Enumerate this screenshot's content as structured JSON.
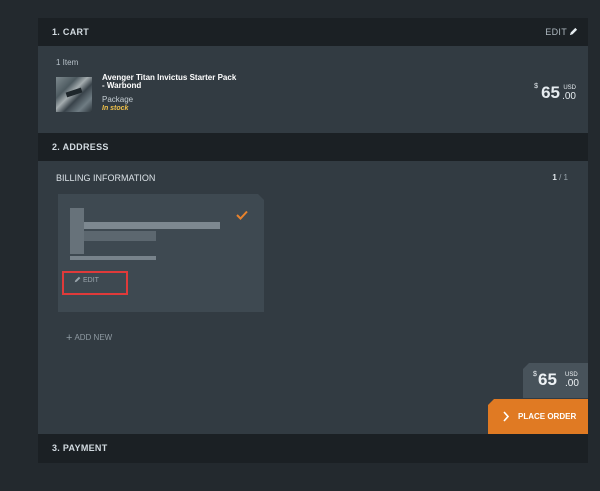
{
  "cart": {
    "header": "1. CART",
    "edit_label": "EDIT",
    "item_count": "1 Item",
    "item": {
      "name": "Avenger Titan Invictus Starter Pack - Warbond",
      "type": "Package",
      "stock": "In stock",
      "currency_symbol": "$",
      "price": "65",
      "cents": ".00",
      "currency": "USD"
    }
  },
  "address": {
    "header": "2. ADDRESS",
    "billing_title": "BILLING INFORMATION",
    "page_current": "1",
    "page_sep": "/",
    "page_total": "1",
    "card_edit_label": "EDIT",
    "add_new_label": "ADD NEW",
    "add_new_icon": "plus-icon",
    "check_icon": "checkmark-icon"
  },
  "order": {
    "currency_symbol": "$",
    "total": "65",
    "cents": ".00",
    "currency": "USD",
    "place_order_label": "PLACE ORDER",
    "accent_color": "#e07a23"
  },
  "payment": {
    "header": "3. PAYMENT"
  },
  "annotation": {
    "highlight_color": "#e03a3a"
  }
}
